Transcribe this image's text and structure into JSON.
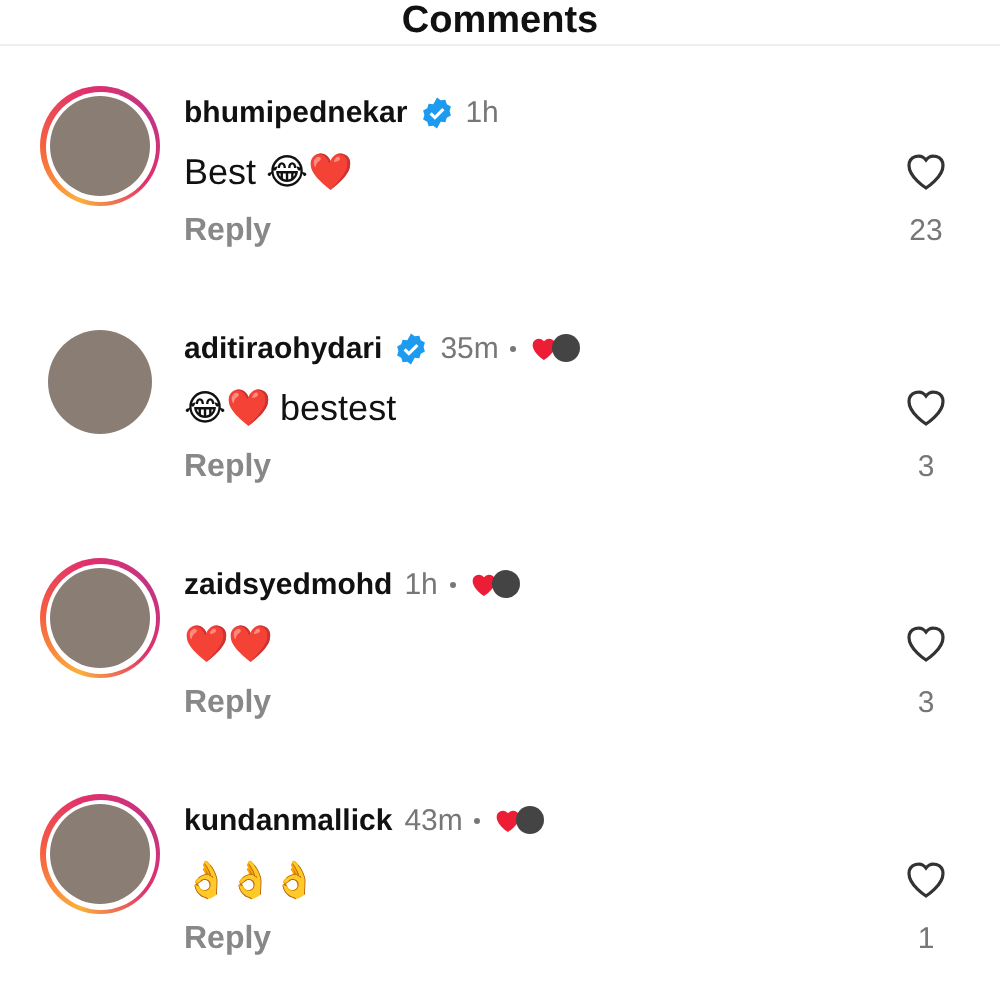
{
  "header": {
    "title": "Comments"
  },
  "comments": [
    {
      "username": "bhumipednekar",
      "verified": true,
      "has_story": true,
      "time": "1h",
      "liked_by_author": false,
      "text": "Best 😂❤️",
      "reply": "Reply",
      "likes": "23"
    },
    {
      "username": "aditiraohydari",
      "verified": true,
      "has_story": false,
      "time": "35m",
      "liked_by_author": true,
      "text": "😂❤️ bestest",
      "reply": "Reply",
      "likes": "3"
    },
    {
      "username": "zaidsyedmohd",
      "verified": false,
      "has_story": true,
      "time": "1h",
      "liked_by_author": true,
      "text": "❤️❤️",
      "reply": "Reply",
      "likes": "3"
    },
    {
      "username": "kundanmallick",
      "verified": false,
      "has_story": true,
      "time": "43m",
      "liked_by_author": true,
      "text": "👌👌👌",
      "reply": "Reply",
      "likes": "1"
    }
  ]
}
